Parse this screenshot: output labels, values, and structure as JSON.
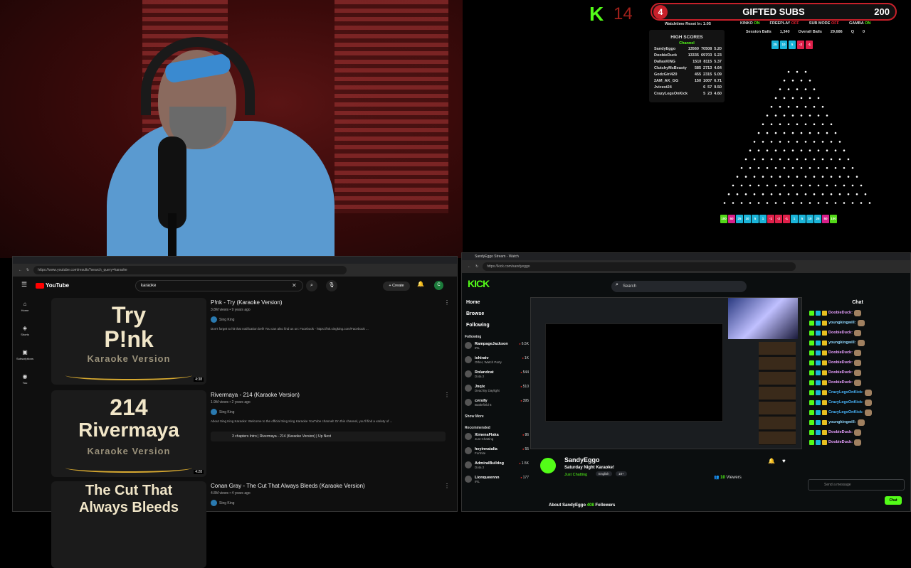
{
  "overlay": {
    "kick_letter": "K",
    "kick_count": "14",
    "gifted": {
      "circle": "4",
      "label": "GIFTED SUBS",
      "count": "200"
    },
    "reset": "Watchtime Reset In: 1:05",
    "status": [
      {
        "name": "KINKO",
        "value": "ON",
        "on": true
      },
      {
        "name": "FREEPLAY",
        "value": "OFF",
        "on": false
      },
      {
        "name": "SUB MODE",
        "value": "OFF",
        "on": false
      },
      {
        "name": "GAMBA",
        "value": "ON",
        "on": true
      }
    ],
    "session": [
      "Session Balls",
      "1,340",
      "Overall Balls",
      "29,686",
      "Q",
      "0"
    ],
    "high_scores": {
      "title": "HIGH SCORES",
      "subtitle": "Channel",
      "rows": [
        [
          "SandyEggo",
          "13560",
          "70508",
          "5.20"
        ],
        [
          "DoobieDuck",
          "13335",
          "69703",
          "5.23"
        ],
        [
          "DallasKING",
          "1510",
          "8115",
          "5.37"
        ],
        [
          "ClutchyMcBeasty",
          "585",
          "2713",
          "4.64"
        ],
        [
          "GodzGirl420",
          "455",
          "2315",
          "5.09"
        ],
        [
          "2AM_AK_GG",
          "150",
          "1007",
          "6.71"
        ],
        [
          "Jvicest24",
          "6",
          "57",
          "9.50"
        ],
        [
          "CrazyLegsOnKick",
          "5",
          "23",
          "4.60"
        ]
      ]
    },
    "top_chips": [
      {
        "label": "25",
        "color": "#1ab4d8"
      },
      {
        "label": "10",
        "color": "#1ab4d8"
      },
      {
        "label": "5",
        "color": "#1ab4d8"
      },
      {
        "label": "-2",
        "color": "#e0204a"
      },
      {
        "label": "-1",
        "color": "#e0204a"
      }
    ],
    "bottom_chips": [
      {
        "label": "100",
        "color": "#53d818"
      },
      {
        "label": "50",
        "color": "#d8208a"
      },
      {
        "label": "25",
        "color": "#1ab4d8"
      },
      {
        "label": "10",
        "color": "#1ab4d8"
      },
      {
        "label": "5",
        "color": "#1ab4d8"
      },
      {
        "label": "1",
        "color": "#1ab4d8"
      },
      {
        "label": "-1",
        "color": "#e0204a"
      },
      {
        "label": "-2",
        "color": "#e0204a"
      },
      {
        "label": "-1",
        "color": "#e0204a"
      },
      {
        "label": "1",
        "color": "#1ab4d8"
      },
      {
        "label": "5",
        "color": "#1ab4d8"
      },
      {
        "label": "10",
        "color": "#1ab4d8"
      },
      {
        "label": "25",
        "color": "#1ab4d8"
      },
      {
        "label": "50",
        "color": "#d8208a"
      },
      {
        "label": "100",
        "color": "#53d818"
      }
    ]
  },
  "youtube": {
    "url": "https://www.youtube.com/results?search_query=karaoke",
    "brand": "YouTube",
    "search_value": "karaoke",
    "create": "Create",
    "avatar_letter": "C",
    "sidebar": [
      {
        "icon": "⌂",
        "label": "Home"
      },
      {
        "icon": "◈",
        "label": "Shorts"
      },
      {
        "icon": "▣",
        "label": "Subscriptions"
      },
      {
        "icon": "◉",
        "label": "You"
      }
    ],
    "videos": [
      {
        "thumb1": "Try",
        "thumb2": "P!nk",
        "thumb3": "Karaoke Version",
        "duration": "4:38",
        "title": "P!nk - Try (Karaoke Version)",
        "meta": "3.8M views • 9 years ago",
        "channel": "Sing King",
        "desc": "Don't forget to hit that notification bell! You can also find us on: Facebook - https://lnk.singking.com/Facebook ..."
      },
      {
        "thumb1": "214",
        "thumb2": "Rivermaya",
        "thumb3": "Karaoke Version",
        "duration": "4:28",
        "title": "Rivermaya - 214 (Karaoke Version)",
        "meta": "1.9M views • 2 years ago",
        "channel": "Sing King",
        "desc": "About Sing King Karaoke: Welcome to the official Sing King Karaoke YouTube channel! On this channel, you'll find a variety of ...",
        "chapters": "3 chapters  Intro | Rivermaya - 214 (Karaoke Version) | Up Next"
      },
      {
        "thumb1": "The Cut That",
        "thumb2": "Always Bleeds",
        "thumb3": "",
        "duration": "",
        "title": "Conan Gray - The Cut That Always Bleeds (Karaoke Version)",
        "meta": "4.8M views • 4 years ago",
        "channel": "Sing King",
        "desc": ""
      }
    ]
  },
  "kick": {
    "tab": "SandyEggo Stream - Watch",
    "url": "https://kick.com/sandyeggo",
    "brand": "KICK",
    "search_placeholder": "Search",
    "nav": [
      "Home",
      "Browse",
      "Following"
    ],
    "following_heading": "Following",
    "following": [
      {
        "name": "RampageJackson",
        "cat": "IRL",
        "count": "6.5K"
      },
      {
        "name": "ishiratv",
        "cat": "Other, Watch Party",
        "count": "1K"
      },
      {
        "name": "Rolandcat",
        "cat": "Dota 2",
        "count": "544"
      },
      {
        "name": "Jnqix",
        "cat": "Dead By Daylight",
        "count": "510"
      },
      {
        "name": "cvrsify",
        "cat": "Battlefield 6",
        "count": "395"
      }
    ],
    "show_more": "Show More",
    "recommended_heading": "Recommended",
    "recommended": [
      {
        "name": "XimenaFlaka",
        "cat": "Just Chatting",
        "count": "86"
      },
      {
        "name": "heyinnatalia",
        "cat": "Fortnite",
        "count": "55"
      },
      {
        "name": "AdmiralBulldog",
        "cat": "Dota 2",
        "count": "1.5K"
      },
      {
        "name": "Lionqueennn",
        "cat": "IRL",
        "count": "177"
      }
    ],
    "streamer": {
      "name": "SandyEggo",
      "title": "Saturday Night Karaoke!",
      "category": "Just Chatting",
      "tags": [
        "English",
        "18+"
      ]
    },
    "viewers": "10",
    "viewers_label": "Viewers",
    "about": "About SandyEggo",
    "followers": "408",
    "followers_label": "Followers",
    "chat_title": "Chat",
    "chat_messages": [
      {
        "user": "DoobieDuck:",
        "color": "#e8a0ff"
      },
      {
        "user": "youngkingwill:",
        "color": "#90d8ff"
      },
      {
        "user": "DoobieDuck:",
        "color": "#e8a0ff"
      },
      {
        "user": "youngkingwill:",
        "color": "#90d8ff"
      },
      {
        "user": "DoobieDuck:",
        "color": "#e8a0ff"
      },
      {
        "user": "DoobieDuck:",
        "color": "#e8a0ff"
      },
      {
        "user": "DoobieDuck:",
        "color": "#e8a0ff"
      },
      {
        "user": "DoobieDuck:",
        "color": "#e8a0ff"
      },
      {
        "user": "CrazyLegsOnKick:",
        "color": "#4ab8ff"
      },
      {
        "user": "CrazyLegsOnKick:",
        "color": "#4ab8ff"
      },
      {
        "user": "CrazyLegsOnKick:",
        "color": "#4ab8ff"
      },
      {
        "user": "youngkingwill:",
        "color": "#90d8ff"
      },
      {
        "user": "DoobieDuck:",
        "color": "#e8a0ff"
      },
      {
        "user": "DoobieDuck:",
        "color": "#e8a0ff"
      }
    ],
    "chat_placeholder": "Send a message",
    "chat_button": "Chat"
  }
}
